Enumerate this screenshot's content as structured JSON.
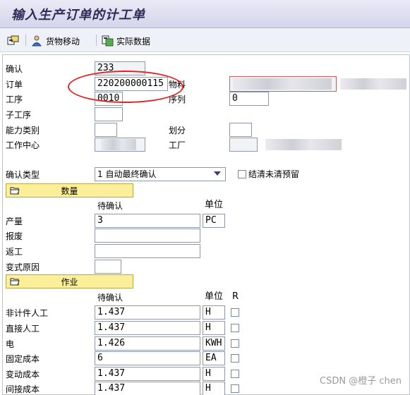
{
  "title": "输入生产订单的计工单",
  "toolbar": {
    "goods_movement": "货物移动",
    "actual_data": "实际数据"
  },
  "header": {
    "confirm_label": "确认",
    "confirm_value": "233",
    "order_label": "订单",
    "order_value": "220200000115",
    "material_label": "物料",
    "operation_label": "工序",
    "operation_value": "0010",
    "sequence_label": "序列",
    "sequence_value": "0",
    "sub_operation_label": "子工序",
    "capacity_category_label": "能力类别",
    "split_label": "划分",
    "work_center_label": "工作中心",
    "plant_label": "工厂"
  },
  "confirmation_type": {
    "label": "确认类型",
    "value": "1 自动最终确认",
    "clear_reservation_label": "结清未清预留"
  },
  "quantity_section": {
    "title": "数量",
    "to_confirm_header": "待确认",
    "unit_header": "单位",
    "yield_label": "产量",
    "yield_value": "3",
    "yield_unit": "PC",
    "scrap_label": "报废",
    "rework_label": "返工",
    "variance_reason_label": "变式原因"
  },
  "activity_section": {
    "title": "作业",
    "to_confirm_header": "待确认",
    "unit_header": "单位",
    "r_header": "R",
    "rows": [
      {
        "label": "非计件人工",
        "value": "1.437",
        "unit": "H"
      },
      {
        "label": "直接人工",
        "value": "1.437",
        "unit": "H"
      },
      {
        "label": "电",
        "value": "1.426",
        "unit": "KWH"
      },
      {
        "label": "固定成本",
        "value": "6",
        "unit": "EA"
      },
      {
        "label": "变动成本",
        "value": "1.437",
        "unit": "H"
      },
      {
        "label": "间接成本",
        "value": "1.437",
        "unit": "H"
      }
    ]
  },
  "watermark": "CSDN @橙子 chen",
  "colors": {
    "section_bar": "#fbef9a",
    "annotation": "#e02424"
  }
}
